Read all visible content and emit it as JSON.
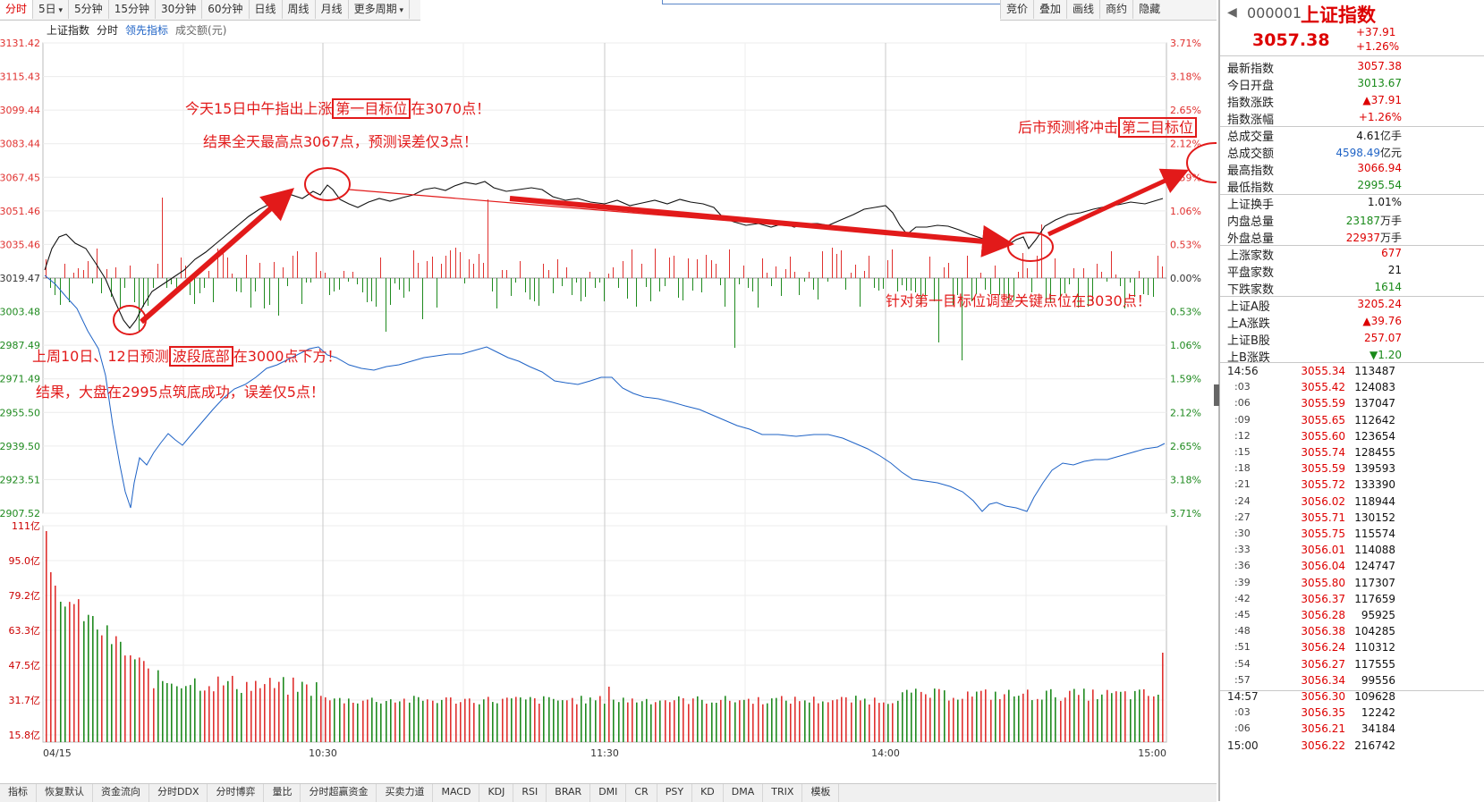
{
  "tabbar": {
    "tabs": [
      "分时",
      "5日",
      "5分钟",
      "15分钟",
      "30分钟",
      "60分钟",
      "日线",
      "周线",
      "月线",
      "更多周期"
    ],
    "active_index": 0
  },
  "tools": [
    "竞价",
    "叠加",
    "画线",
    "商约",
    "隐藏"
  ],
  "legend": {
    "index": "上证指数",
    "mode": "分时",
    "lead": "领先指标",
    "amount": "成交额(元)"
  },
  "chart": {
    "price_levels": [
      "3131.42",
      "3115.43",
      "3099.44",
      "3083.44",
      "3067.45",
      "3051.46",
      "3035.46",
      "3019.47",
      "3003.48",
      "2987.49",
      "2971.49",
      "2955.50",
      "2939.50",
      "2923.51",
      "2907.52"
    ],
    "pct_levels": [
      "3.71%",
      "3.18%",
      "2.65%",
      "2.12%",
      "1.59%",
      "1.06%",
      "0.53%",
      "0.00%",
      "0.53%",
      "1.06%",
      "1.59%",
      "2.12%",
      "2.65%",
      "3.18%",
      "3.71%"
    ],
    "vol_levels": [
      "111亿",
      "95.0亿",
      "79.2亿",
      "63.3亿",
      "47.5亿",
      "31.7亿",
      "15.8亿"
    ],
    "time_labels": [
      "04/15",
      "10:30",
      "11:30",
      "14:00",
      "15:00"
    ],
    "colors": {
      "up": "#e0312f",
      "down": "#1f8a1f",
      "price_line": "#111111",
      "lead_line": "#1f63c6",
      "annot": "#e21a1a"
    }
  },
  "annotations": {
    "note1_a": "今天15日中午指出上涨",
    "note1_box": "第一目标位",
    "note1_b": "在3070点！",
    "note2": "结果全天最高点3067点，预测误差仅3点！",
    "note3_a": "上周10日、12日预测",
    "note3_box": "波段底部",
    "note3_b": "在3000点下方！",
    "note4": "结果，大盘在2995点筑底成功，误差仅5点！",
    "note5_a": "后市预测将冲击",
    "note5_box": "第二目标位",
    "note6": "针对第一目标位调整关键点位在3030点！"
  },
  "bottom_tabs": [
    "指标",
    "恢复默认",
    "资金流向",
    "分时DDX",
    "分时博弈",
    "量比",
    "分时超赢资金",
    "买卖力道",
    "MACD",
    "KDJ",
    "RSI",
    "BRAR",
    "DMI",
    "CR",
    "PSY",
    "KD",
    "DMA",
    "TRIX",
    "模板"
  ],
  "quote": {
    "code": "000001",
    "name": "上证指数",
    "price": "3057.38",
    "change": "+37.91",
    "pct": "+1.26%",
    "stats": [
      {
        "label": "最新指数",
        "value": "3057.38",
        "unit": "",
        "color": "#d00"
      },
      {
        "label": "今日开盘",
        "value": "3013.67",
        "unit": "",
        "color": "#1a8a1a"
      },
      {
        "label": "指数涨跌",
        "value": "▲37.91",
        "unit": "",
        "color": "#d00"
      },
      {
        "label": "指数涨幅",
        "value": "+1.26%",
        "unit": "",
        "color": "#d00"
      },
      {
        "label": "总成交量",
        "value": "4.61",
        "unit": "亿手",
        "color": "#111"
      },
      {
        "label": "总成交额",
        "value": "4598.49",
        "unit": "亿元",
        "color": "#1f63c6"
      },
      {
        "label": "最高指数",
        "value": "3066.94",
        "unit": "",
        "color": "#d00"
      },
      {
        "label": "最低指数",
        "value": "2995.54",
        "unit": "",
        "color": "#1a8a1a"
      },
      {
        "label": "上证换手",
        "value": "1.01%",
        "unit": "",
        "color": "#111"
      },
      {
        "label": "内盘总量",
        "value": "23187",
        "unit": "万手",
        "color": "#1a8a1a"
      },
      {
        "label": "外盘总量",
        "value": "22937",
        "unit": "万手",
        "color": "#d00"
      },
      {
        "label": "上涨家数",
        "value": "677",
        "unit": "",
        "color": "#d00"
      },
      {
        "label": "平盘家数",
        "value": "21",
        "unit": "",
        "color": "#111"
      },
      {
        "label": "下跌家数",
        "value": "1614",
        "unit": "",
        "color": "#1a8a1a"
      },
      {
        "label": "上证A股",
        "value": "3205.24",
        "unit": "",
        "color": "#d00"
      },
      {
        "label": "上A涨跌",
        "value": "▲39.76",
        "unit": "",
        "color": "#d00"
      },
      {
        "label": "上证B股",
        "value": "257.07",
        "unit": "",
        "color": "#d00"
      },
      {
        "label": "上B涨跌",
        "value": "▼1.20",
        "unit": "",
        "color": "#1a8a1a"
      }
    ],
    "ticks": [
      {
        "t": "14:56",
        "p": "3055.34",
        "q": "113487"
      },
      {
        "t": ":03",
        "p": "3055.42",
        "q": "124083"
      },
      {
        "t": ":06",
        "p": "3055.59",
        "q": "137047"
      },
      {
        "t": ":09",
        "p": "3055.65",
        "q": "112642"
      },
      {
        "t": ":12",
        "p": "3055.60",
        "q": "123654"
      },
      {
        "t": ":15",
        "p": "3055.74",
        "q": "128455"
      },
      {
        "t": ":18",
        "p": "3055.59",
        "q": "139593"
      },
      {
        "t": ":21",
        "p": "3055.72",
        "q": "133390"
      },
      {
        "t": ":24",
        "p": "3056.02",
        "q": "118944"
      },
      {
        "t": ":27",
        "p": "3055.71",
        "q": "130152"
      },
      {
        "t": ":30",
        "p": "3055.75",
        "q": "115574"
      },
      {
        "t": ":33",
        "p": "3056.01",
        "q": "114088"
      },
      {
        "t": ":36",
        "p": "3056.04",
        "q": "124747"
      },
      {
        "t": ":39",
        "p": "3055.80",
        "q": "117307"
      },
      {
        "t": ":42",
        "p": "3056.37",
        "q": "117659"
      },
      {
        "t": ":45",
        "p": "3056.28",
        "q": "95925"
      },
      {
        "t": ":48",
        "p": "3056.38",
        "q": "104285"
      },
      {
        "t": ":51",
        "p": "3056.24",
        "q": "110312"
      },
      {
        "t": ":54",
        "p": "3056.27",
        "q": "117555"
      },
      {
        "t": ":57",
        "p": "3056.34",
        "q": "99556"
      },
      {
        "t": "14:57",
        "p": "3056.30",
        "q": "109628"
      },
      {
        "t": ":03",
        "p": "3056.35",
        "q": "12242"
      },
      {
        "t": ":06",
        "p": "3056.21",
        "q": "34184"
      },
      {
        "t": "15:00",
        "p": "3056.22",
        "q": "216742"
      }
    ]
  }
}
